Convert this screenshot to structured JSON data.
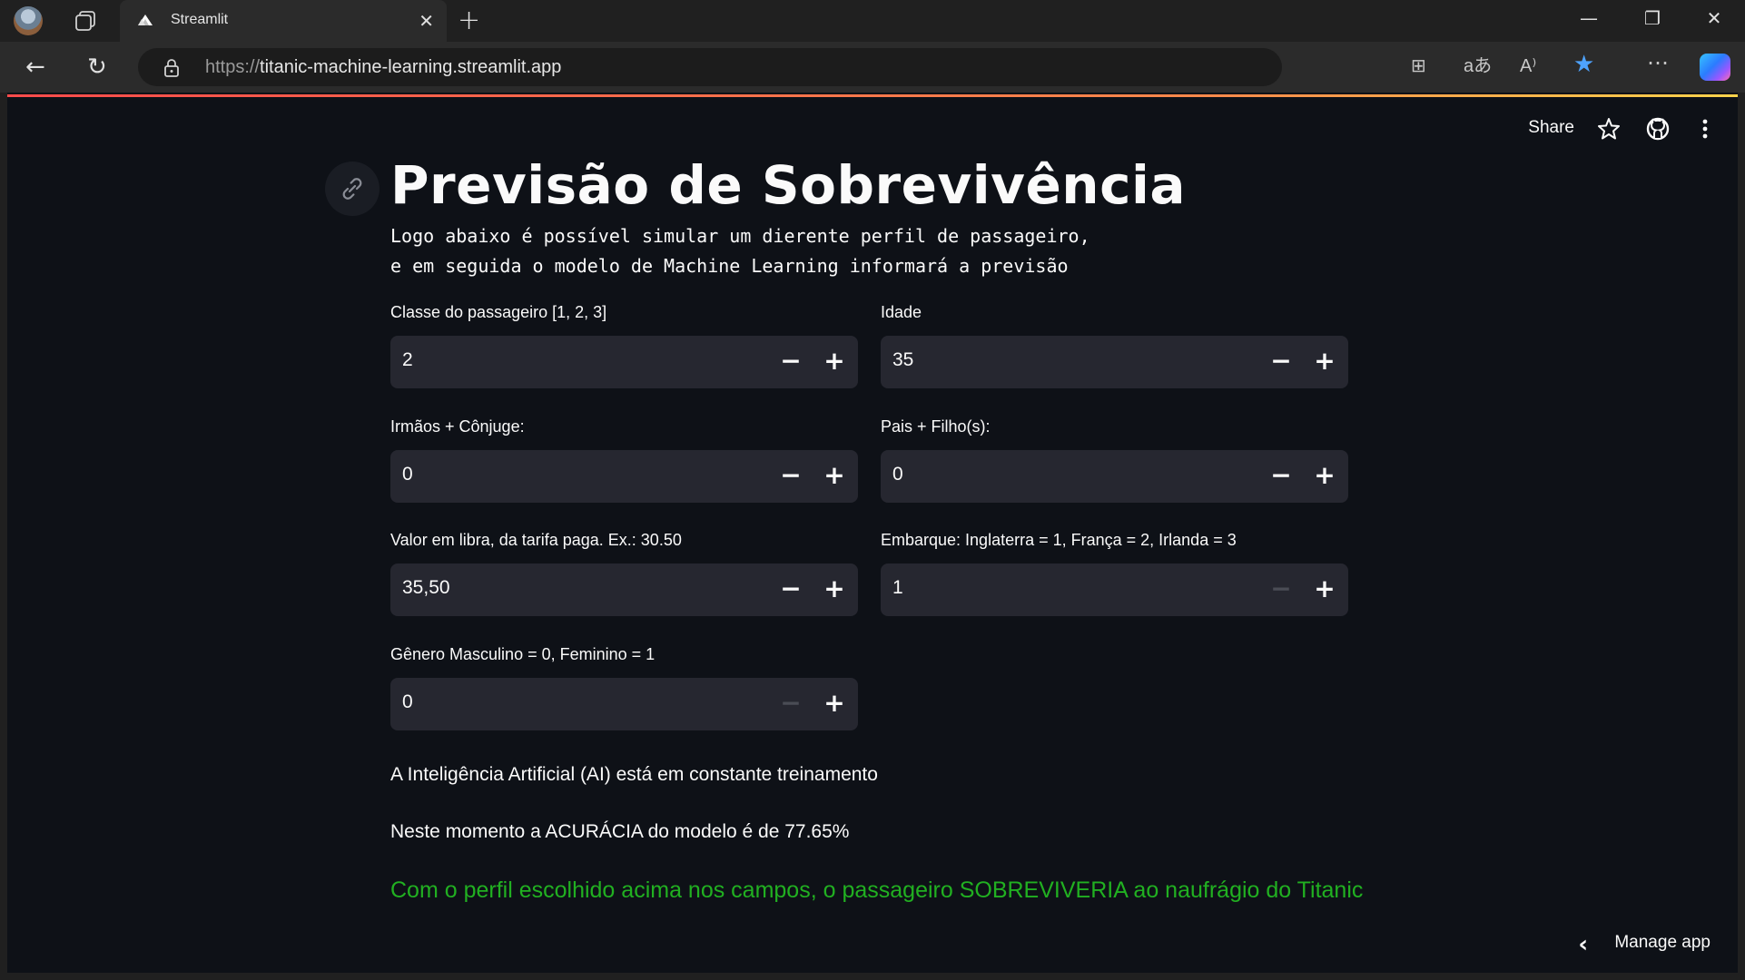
{
  "browser": {
    "tab_title": "Streamlit",
    "url_scheme": "https://",
    "url_host": "titanic-machine-learning.streamlit.app",
    "icons": [
      "back-icon",
      "refresh-icon",
      "lock-icon",
      "app-view-icon",
      "translate-icon",
      "read-aloud-icon",
      "favorite-star-icon",
      "more-icon",
      "copilot-icon"
    ]
  },
  "toolbar": {
    "share_label": "Share"
  },
  "page": {
    "title": "Previsão de Sobrevivência",
    "subtitle": "Logo abaixo é possível simular um dierente perfil de passageiro,\ne em seguida o modelo de Machine Learning informará a previsão"
  },
  "fields": [
    {
      "label": "Classe do passageiro [1, 2, 3]",
      "value": "2",
      "minus_disabled": false
    },
    {
      "label": "Idade",
      "value": "35",
      "minus_disabled": false
    },
    {
      "label": "Irmãos + Cônjuge:",
      "value": "0",
      "minus_disabled": false
    },
    {
      "label": "Pais + Filho(s):",
      "value": "0",
      "minus_disabled": false
    },
    {
      "label": "Valor em libra, da tarifa paga. Ex.: 30.50",
      "value": "35,50",
      "minus_disabled": false
    },
    {
      "label": "Embarque: Inglaterra = 1, França = 2, Irlanda = 3",
      "value": "1",
      "minus_disabled": true
    },
    {
      "label": "Gênero Masculino = 0, Feminino = 1",
      "value": "0",
      "minus_disabled": true
    }
  ],
  "info": {
    "training": "A Inteligência Artificial (AI) está em constante treinamento",
    "accuracy": "Neste momento a ACURÁCIA do modelo é de 77.65%",
    "result": "Com o perfil escolhido acima nos campos, o passageiro SOBREVIVERIA ao naufrágio do Titanic",
    "result_color": "#21b021"
  },
  "manage": {
    "label": "Manage app"
  },
  "colors": {
    "app_bg": "#0e1117",
    "input_bg": "#262730",
    "text": "#fafafa"
  }
}
